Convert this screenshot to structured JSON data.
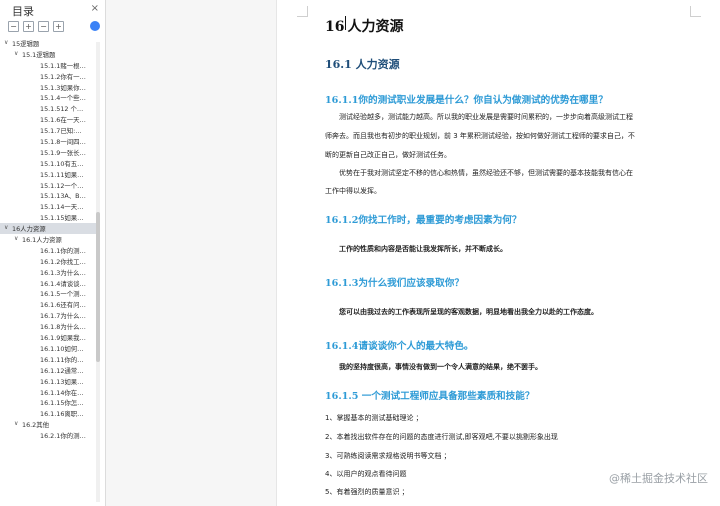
{
  "nav": {
    "title": "目录",
    "close_icon": "×",
    "tools": [
      "−",
      "+",
      "−",
      "+"
    ],
    "items": [
      {
        "label": "15逻辑题",
        "level": 1,
        "arrow": "∨"
      },
      {
        "label": "15.1逻辑题",
        "level": 2,
        "arrow": "∨"
      },
      {
        "label": "15.1.1赌一根…",
        "level": 3
      },
      {
        "label": "15.1.2你有一…",
        "level": 3
      },
      {
        "label": "15.1.3如果你…",
        "level": 3
      },
      {
        "label": "15.1.4一个些…",
        "level": 3
      },
      {
        "label": "15.1.512 个…",
        "level": 3
      },
      {
        "label": "15.1.6在一天…",
        "level": 3
      },
      {
        "label": "15.1.7已知:…",
        "level": 3
      },
      {
        "label": "15.1.8一间四…",
        "level": 3
      },
      {
        "label": "15.1.9一张长…",
        "level": 3
      },
      {
        "label": "15.1.10有五…",
        "level": 3
      },
      {
        "label": "15.1.11如果…",
        "level": 3
      },
      {
        "label": "15.1.12一个…",
        "level": 3
      },
      {
        "label": "15.1.13A、B…",
        "level": 3
      },
      {
        "label": "15.1.14一天…",
        "level": 3
      },
      {
        "label": "15.1.15如果…",
        "level": 3
      },
      {
        "label": "16人力资源",
        "level": 1,
        "arrow": "∨",
        "selected": true
      },
      {
        "label": "16.1人力资源",
        "level": 2,
        "arrow": "∨"
      },
      {
        "label": "16.1.1你的测…",
        "level": 3
      },
      {
        "label": "16.1.2你找工…",
        "level": 3
      },
      {
        "label": "16.1.3为什么…",
        "level": 3
      },
      {
        "label": "16.1.4请谈谈…",
        "level": 3
      },
      {
        "label": "16.1.5一个测…",
        "level": 3
      },
      {
        "label": "16.1.6还有问…",
        "level": 3
      },
      {
        "label": "16.1.7为什么…",
        "level": 3
      },
      {
        "label": "16.1.8为什么…",
        "level": 3
      },
      {
        "label": "16.1.9如果我…",
        "level": 3
      },
      {
        "label": "16.1.10如何…",
        "level": 3
      },
      {
        "label": "16.1.11你的…",
        "level": 3
      },
      {
        "label": "16.1.12通常…",
        "level": 3
      },
      {
        "label": "16.1.13如果…",
        "level": 3
      },
      {
        "label": "16.1.14你在…",
        "level": 3
      },
      {
        "label": "16.1.15你怎…",
        "level": 3
      },
      {
        "label": "16.1.16离职…",
        "level": 3
      },
      {
        "label": "16.2其他",
        "level": 2,
        "arrow": "∨"
      },
      {
        "label": "16.2.1你的测…",
        "level": 3
      }
    ]
  },
  "doc": {
    "h1_num": "16",
    "h1_text": "人力资源",
    "h2": "16.1   人力资源",
    "q1": "16.1.1你的测试职业发展是什么？你自认为做测试的优势在哪里？",
    "p1a": "测试经验越多，测试能力越高。所以我的职业发展是需要时间累积的，一步步向着高级测试工程",
    "p1b": "师奔去。而且我也有初步的职业规划，前 3 年累积测试经验，按如何做好测试工程师的要求自己，不",
    "p1c": "断的更新自己改正自己，做好测试任务。",
    "p2a": "优势在于我对测试坚定不移的信心和热情，虽然经验还不够，但测试需要的基本技能我有信心在",
    "p2b": "工作中得以发挥。",
    "q2": "16.1.2你找工作时，最重要的考虑因素为何？",
    "a2": "工作的性质和内容是否能让我发挥所长，并不断成长。",
    "q3": "16.1.3为什么我们应该录取你？",
    "a3": "您可以由我过去的工作表现所呈现的客观数据，明显地看出我全力以赴的工作态度。",
    "q4": "16.1.4请谈谈你个人的最大特色。",
    "a4": "我的坚持度很高，事情没有做到一个令人满意的结果，绝不罢手。",
    "q5": "16.1.5 一个测试工程师应具备那些素质和技能？",
    "l1": "1、掌握基本的测试基础理论 ；",
    "l2": "2、本着找出软件存在的问题的态度进行测试,即客观吧,不要以挑剔形象出现",
    "l3": "3、可熟练阅读需求规格说明书等文档 ；",
    "l4": "4、以用户的观点看待问题",
    "l5": "5、有着强烈的质量意识 ；"
  },
  "watermark": "@稀土掘金技术社区",
  "colors": {
    "accent": "#2e9bd6",
    "heading": "#1f4e79",
    "selected": "#d9dde3"
  }
}
